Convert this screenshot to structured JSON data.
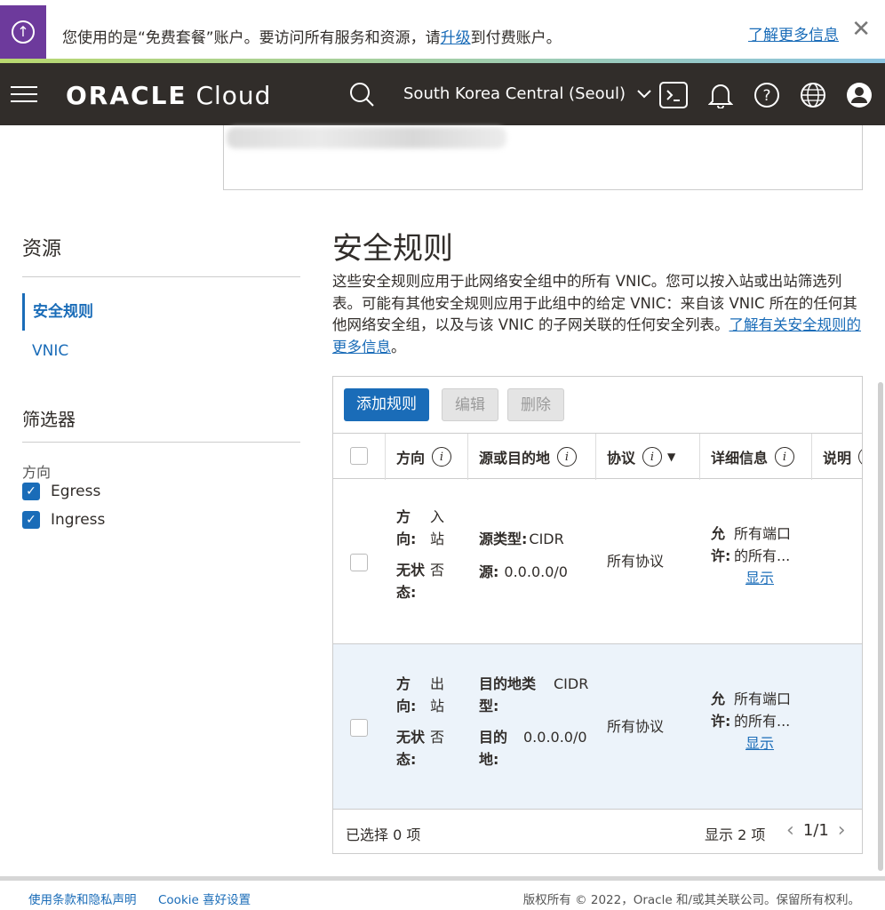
{
  "banner": {
    "text_before": "您使用的是“免费套餐”账户。要访问所有服务和资源，请",
    "upgrade_link": "升级",
    "text_after": "到付费账户。",
    "more_link": "了解更多信息",
    "close": "✕"
  },
  "header": {
    "logo_bold": "ORACLE",
    "logo_light": " Cloud",
    "region": "South Korea Central (Seoul)"
  },
  "sidebar": {
    "resources_title": "资源",
    "items": [
      {
        "label": "安全规则",
        "active": true
      },
      {
        "label": "VNIC",
        "active": false
      }
    ],
    "filters_title": "筛选器",
    "direction_label": "方向",
    "checkboxes": [
      {
        "label": "Egress",
        "checked": true
      },
      {
        "label": "Ingress",
        "checked": true
      }
    ]
  },
  "main": {
    "title": "安全规则",
    "desc_text": "这些安全规则应用于此网络安全组中的所有 VNIC。您可以按入站或出站筛选列表。可能有其他安全规则应用于此组中的给定 VNIC：来自该 VNIC 所在的任何其他网络安全组，以及与该 VNIC 的子网关联的任何安全列表。",
    "desc_link": "了解有关安全规则的更多信息",
    "desc_end": "。"
  },
  "toolbar": {
    "add": "添加规则",
    "edit": "编辑",
    "delete": "删除"
  },
  "table": {
    "headers": {
      "direction": "方向",
      "source_dest": "源或目的地",
      "protocol": "协议",
      "details": "详细信息",
      "description": "说明"
    },
    "rows": [
      {
        "dir_key": "方向:",
        "dir_val": "入站",
        "state_key": "无状态:",
        "state_val": "否",
        "type_key": "源类型:",
        "type_val": "CIDR",
        "addr_key": "源:",
        "addr_val": "0.0.0.0/0",
        "protocol": "所有协议",
        "allow_key": "允许:",
        "allow_val": "所有端口的所有...",
        "show": "显示"
      },
      {
        "dir_key": "方向:",
        "dir_val": "出站",
        "state_key": "无状态:",
        "state_val": "否",
        "type_key": "目的地类型:",
        "type_val": "CIDR",
        "addr_key": "目的地:",
        "addr_val": "0.0.0.0/0",
        "protocol": "所有协议",
        "allow_key": "允许:",
        "allow_val": "所有端口的所有...",
        "show": "显示"
      }
    ],
    "selected": "已选择 0 项",
    "showing": "显示 2 项",
    "page": "1/1"
  },
  "footer": {
    "terms": "使用条款和隐私声明",
    "cookie": "Cookie 喜好设置",
    "copyright": "版权所有 © 2022，Oracle 和/或其关联公司。保留所有权利。"
  }
}
